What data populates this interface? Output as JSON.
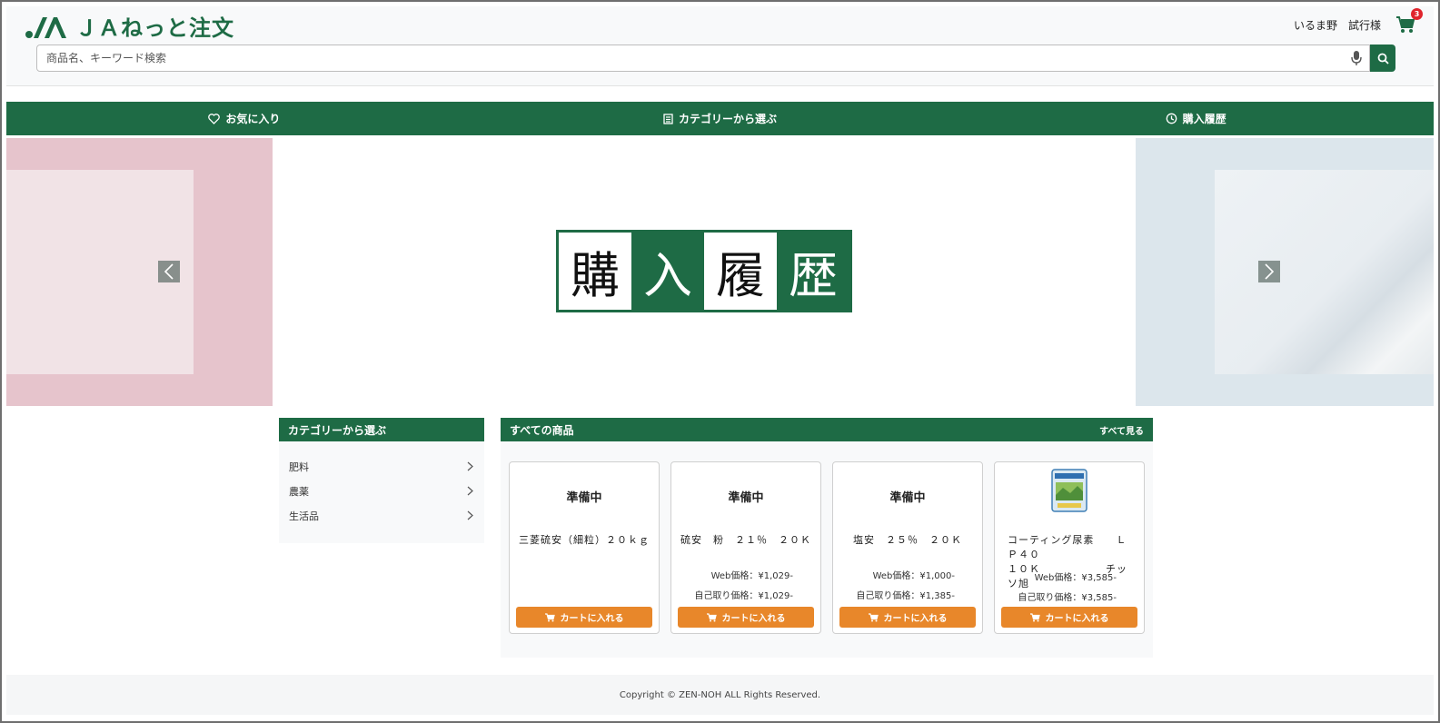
{
  "header": {
    "logo_text": "ＪＡねっと注文",
    "user_region": "いるま野",
    "user_name": "試行様",
    "cart_count": "3",
    "search_placeholder": "商品名、キーワード検索"
  },
  "nav": {
    "favorites": "お気に入り",
    "categories": "カテゴリーから選ぶ",
    "history": "購入履歴"
  },
  "banner": {
    "kanji": [
      "購",
      "入",
      "履",
      "歴"
    ]
  },
  "category_panel": {
    "title": "カテゴリーから選ぶ",
    "items": [
      "肥料",
      "農薬",
      "生活品"
    ]
  },
  "product_panel": {
    "title": "すべての商品",
    "see_all": "すべて見る",
    "cart_button_label": "カートに入れる",
    "products": [
      {
        "status": "準備中",
        "name": "三菱硫安（細粒）２０ｋｇ",
        "web_price": "",
        "pickup_price": ""
      },
      {
        "status": "準備中",
        "name": "硫安　粉　２１％　２０Ｋ",
        "web_price": "Web価格：¥1,029-",
        "pickup_price": "自己取り価格：¥1,029-"
      },
      {
        "status": "準備中",
        "name": "塩安　２５％　２０Ｋ",
        "web_price": "Web価格：¥1,000-",
        "pickup_price": "自己取り価格：¥1,385-"
      },
      {
        "status": "",
        "name_line1": "コーティング尿素　　ＬＰ４０",
        "name_line2": "１０Ｋ　　　　　　チッソ旭",
        "web_price": "Web価格：¥3,585-",
        "pickup_price": "自己取り価格：¥3,585-"
      }
    ]
  },
  "footer": {
    "copyright": "Copyright © ZEN-NOH ALL Rights Reserved."
  },
  "colors": {
    "brand_green": "#1e6b45",
    "cart_orange": "#e8872a",
    "badge_red": "#e0242c"
  }
}
